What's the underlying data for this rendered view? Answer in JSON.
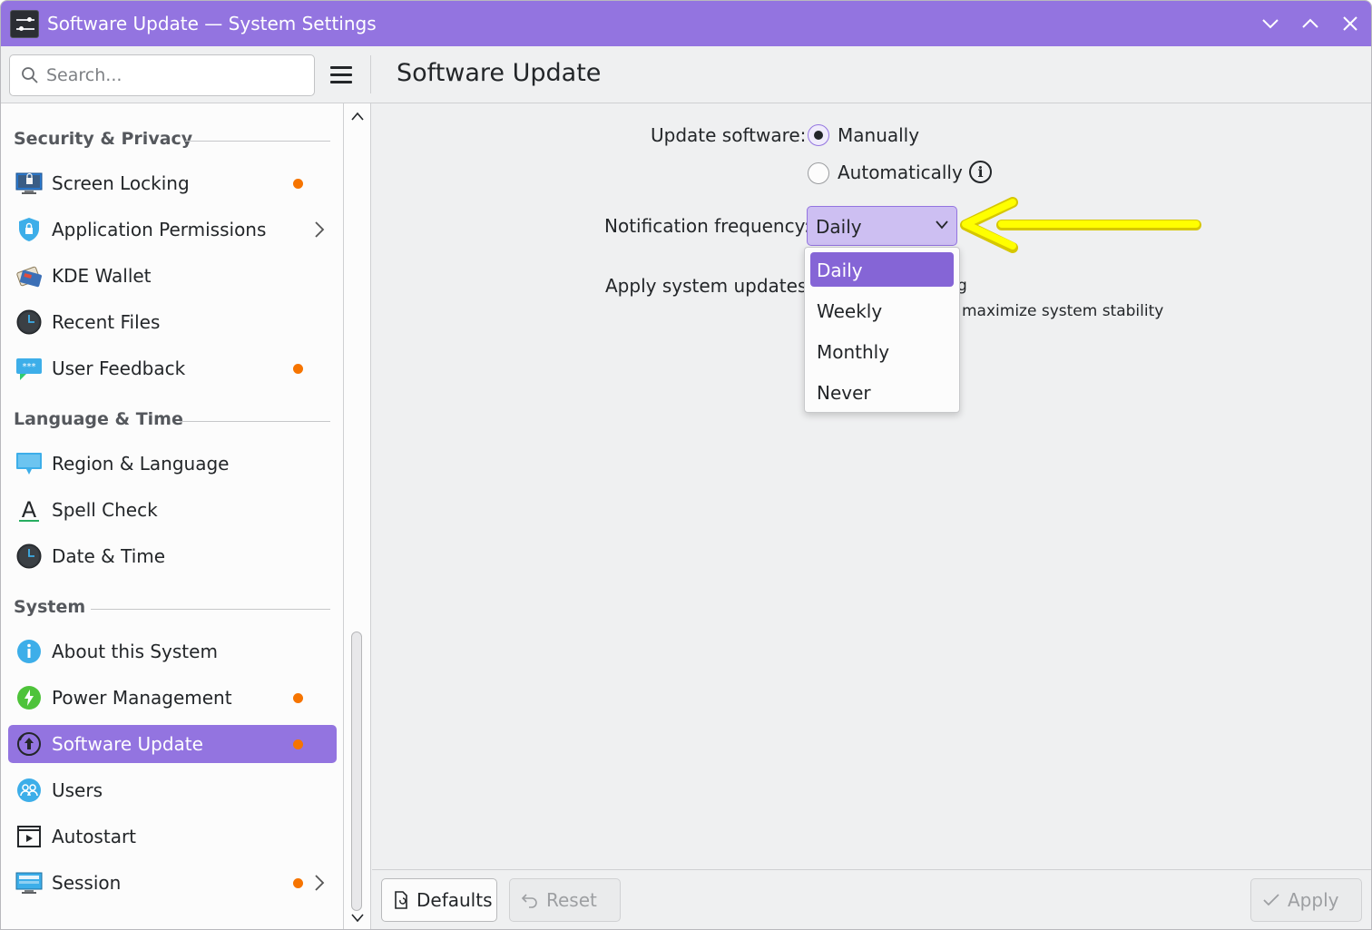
{
  "window": {
    "title": "Software Update — System Settings",
    "app_icon": "system-settings-icon",
    "controls": [
      "minimize-icon",
      "maximize-icon",
      "close-icon"
    ]
  },
  "search": {
    "placeholder": "Search...",
    "value": ""
  },
  "page_title": "Software Update",
  "sidebar": {
    "sections": [
      {
        "header": "Security & Privacy",
        "items": [
          {
            "label": "Screen Locking",
            "icon": "screen-lock-icon",
            "badge": true,
            "submenu": false
          },
          {
            "label": "Application Permissions",
            "icon": "shield-icon",
            "badge": false,
            "submenu": true
          },
          {
            "label": "KDE Wallet",
            "icon": "wallet-icon",
            "badge": false,
            "submenu": false
          },
          {
            "label": "Recent Files",
            "icon": "clock-icon",
            "badge": false,
            "submenu": false
          },
          {
            "label": "User Feedback",
            "icon": "feedback-icon",
            "badge": true,
            "submenu": false
          }
        ]
      },
      {
        "header": "Language & Time",
        "items": [
          {
            "label": "Region & Language",
            "icon": "region-icon",
            "badge": false,
            "submenu": false
          },
          {
            "label": "Spell Check",
            "icon": "spell-check-icon",
            "badge": false,
            "submenu": false
          },
          {
            "label": "Date & Time",
            "icon": "clock-icon",
            "badge": false,
            "submenu": false
          }
        ]
      },
      {
        "header": "System",
        "items": [
          {
            "label": "About this System",
            "icon": "info-icon",
            "badge": false,
            "submenu": false
          },
          {
            "label": "Power Management",
            "icon": "power-icon",
            "badge": true,
            "submenu": false
          },
          {
            "label": "Software Update",
            "icon": "update-icon",
            "badge": true,
            "submenu": false,
            "selected": true
          },
          {
            "label": "Users",
            "icon": "users-icon",
            "badge": false,
            "submenu": false
          },
          {
            "label": "Autostart",
            "icon": "autostart-icon",
            "badge": false,
            "submenu": false
          },
          {
            "label": "Session",
            "icon": "session-icon",
            "badge": true,
            "submenu": true
          }
        ]
      }
    ]
  },
  "form": {
    "update_software_label": "Update software:",
    "options": [
      {
        "label": "Manually",
        "checked": true
      },
      {
        "label": "Automatically",
        "checked": false
      }
    ],
    "notification_frequency_label": "Notification frequency:",
    "notification_frequency_value": "Daily",
    "apply_updates_label": "Apply system updates:",
    "apply_updates_partial_1": "g",
    "apply_updates_partial_2": "maximize system stability"
  },
  "dropdown": {
    "options": [
      "Daily",
      "Weekly",
      "Monthly",
      "Never"
    ],
    "selected": "Daily"
  },
  "footer": {
    "defaults_label": "Defaults",
    "reset_label": "Reset",
    "apply_label": "Apply"
  },
  "colors": {
    "accent": "#9374e0",
    "badge": "#f67400",
    "annotation_arrow": "#ffff00"
  }
}
